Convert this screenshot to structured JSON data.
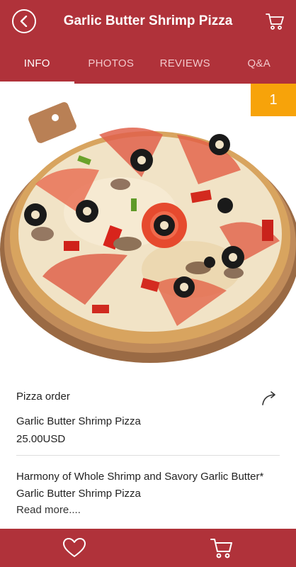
{
  "header": {
    "title": "Garlic Butter Shrimp Pizza",
    "back_icon": "back-arrow-icon",
    "cart_icon": "cart-icon"
  },
  "tabs": [
    {
      "label": "INFO",
      "active": true
    },
    {
      "label": "PHOTOS",
      "active": false
    },
    {
      "label": "REVIEWS",
      "active": false
    },
    {
      "label": "Q&A",
      "active": false
    }
  ],
  "badge": {
    "count": "1"
  },
  "product": {
    "category": "Pizza order",
    "name": "Garlic Butter Shrimp Pizza",
    "price": "25.00USD",
    "description": "Harmony of Whole Shrimp and Savory Garlic Butter* Garlic Butter Shrimp Pizza",
    "read_more": "Read more....",
    "share_icon": "share-icon"
  },
  "bottom_bar": {
    "favorite_icon": "heart-icon",
    "cart_icon": "cart-icon"
  },
  "colors": {
    "primary": "#b0323a",
    "badge": "#f7a30a",
    "tab_inactive": "#f2c8cb"
  }
}
